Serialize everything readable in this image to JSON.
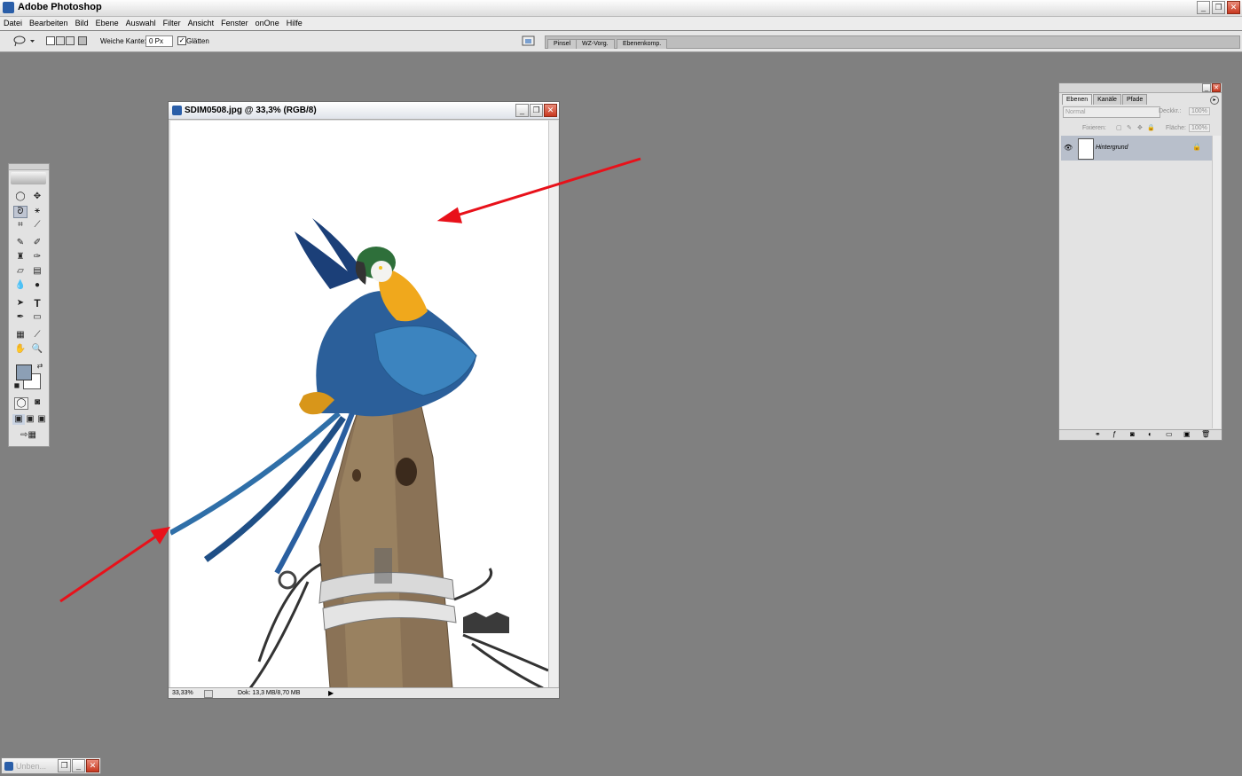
{
  "app": {
    "title": "Adobe Photoshop"
  },
  "window_controls": {
    "minimize": "_",
    "restore": "❐",
    "close": "✕"
  },
  "menubar": [
    "Datei",
    "Bearbeiten",
    "Bild",
    "Ebene",
    "Auswahl",
    "Filter",
    "Ansicht",
    "Fenster",
    "onOne",
    "Hilfe"
  ],
  "options_bar": {
    "feather_label": "Weiche Kante:",
    "feather_value": "0 Px",
    "antialias_label": "Glätten",
    "antialias_checked": true,
    "palette_tabs": [
      "Pinsel",
      "WZ-Vorg.",
      "Ebenenkomp."
    ]
  },
  "toolbox": {
    "foreground_color": "#8c9fb5",
    "background_color": "#ffffff",
    "tools": [
      "marquee-tool",
      "move-tool",
      "lasso-tool",
      "magic-wand-tool",
      "crop-tool",
      "slice-tool",
      "healing-brush-tool",
      "brush-tool",
      "clone-stamp-tool",
      "history-brush-tool",
      "eraser-tool",
      "gradient-tool",
      "blur-tool",
      "dodge-tool",
      "path-selection-tool",
      "type-tool",
      "pen-tool",
      "shape-tool",
      "notes-tool",
      "eyedropper-tool",
      "hand-tool",
      "zoom-tool"
    ],
    "type_glyph": "T"
  },
  "document": {
    "title": "SDIM0508.jpg @ 33,3% (RGB/8)",
    "zoom": "33,33%",
    "doc_size": "Dok: 13,3 MB/8,70 MB"
  },
  "layers_panel": {
    "tabs": [
      "Ebenen",
      "Kanäle",
      "Pfade"
    ],
    "blend_mode": "Normal",
    "opacity_label": "Deckkr.:",
    "opacity_value": "100%",
    "lock_label": "Fixieren:",
    "fill_label": "Fläche:",
    "fill_value": "100%",
    "layer_name": "Hintergrund"
  },
  "minimized_window": {
    "title": "Unben..."
  },
  "annotation_color": "#e8111a"
}
